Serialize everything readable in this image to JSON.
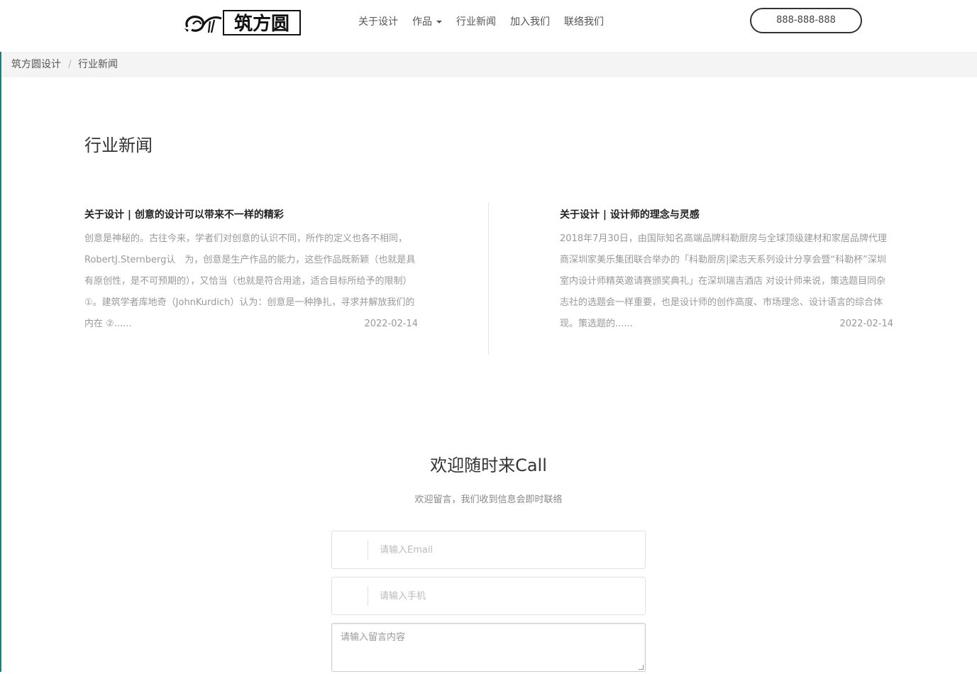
{
  "header": {
    "logo_icon": "swan-logo-icon",
    "logo_text": "筑方圆",
    "nav": [
      {
        "label": "关于设计"
      },
      {
        "label": "作品",
        "has_dropdown": true
      },
      {
        "label": "行业新闻"
      },
      {
        "label": "加入我们"
      },
      {
        "label": "联络我们"
      }
    ],
    "phone": "888-888-888"
  },
  "breadcrumb": {
    "home": "筑方圆设计",
    "separator": "/",
    "current": "行业新闻"
  },
  "page": {
    "title": "行业新闻"
  },
  "news": [
    {
      "title": "关于设计 | 创意的设计可以带来不一样的精彩",
      "excerpt": "创意是神秘的。古往今来，学者们对创意的认识不同，所作的定义也各不相同，RobertJ.Sternberg认　为，创意是生产作品的能力，这些作品既新颖（也就是具有原创性，是不可预期的），又恰当（也就是符合用途，适合目标所给予的限制）①。建筑学者库地奇（JohnKurdich）认为：创意是一种挣扎，寻求并解放我们的内在 ②......",
      "date": "2022-02-14"
    },
    {
      "title": "关于设计 | 设计师的理念与灵感",
      "excerpt": "2018年7月30日，由国际知名高端品牌科勒厨房与全球顶级建材和家居品牌代理商深圳家美乐集团联合举办的「科勒厨房|梁志天系列设计分享会暨“科勒杯”深圳室内设计师精英邀请赛颁奖典礼」在深圳瑞吉酒店 对设计师来说，策选题目同杂志社的选题会一样重要，也是设计师的创作高度、市场理念、设计语言的综合体现。策选题的......",
      "date": "2022-02-14"
    }
  ],
  "contact": {
    "title": "欢迎随时来Call",
    "subtitle": "欢迎留言，我们收到信息会即时联络",
    "email_placeholder": "请输入Email",
    "phone_placeholder": "请输入手机",
    "message_placeholder": "请输入留言内容"
  },
  "colors": {
    "accent_border": "#2c7a74",
    "breadcrumb_bg": "#f4f4f4",
    "muted_text": "#999999"
  }
}
